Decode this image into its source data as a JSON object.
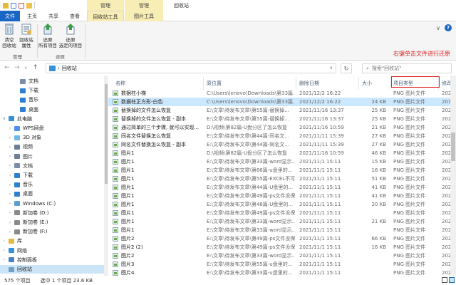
{
  "titlebar": {
    "context_tabs": [
      "管理",
      "管理"
    ],
    "title": "回收站"
  },
  "ribbon_tabs": {
    "file": "文件",
    "home": "主页",
    "share": "共享",
    "view": "查看",
    "recycle_tools": "回收站工具",
    "picture_tools": "图片工具"
  },
  "ribbon": {
    "empty_recycle": "清空\n回收站",
    "recycle_props": "回收站\n属性",
    "restore_all": "还原\n所有项目",
    "restore_selected": "还原\n选定的项目",
    "group_manage": "管理",
    "group_restore": "还原"
  },
  "annotation": "右键单击文件进行还原",
  "address": {
    "path_sep": "›",
    "path": "回收站",
    "search_placeholder": "搜索\"回收站\""
  },
  "nav": {
    "up": "↑",
    "back": "←",
    "forward": "→",
    "history": "∨",
    "refresh": "↻"
  },
  "navpane": [
    {
      "label": "文档",
      "color": "#7a8fa6",
      "arrow": ""
    },
    {
      "label": "下载",
      "color": "#2f7fd0",
      "arrow": ""
    },
    {
      "label": "音乐",
      "color": "#2f7fd0",
      "arrow": ""
    },
    {
      "label": "桌面",
      "color": "#2f7fd0",
      "arrow": ""
    },
    {
      "label": "此电脑",
      "color": "#3a8fd9",
      "arrow": "∨"
    },
    {
      "label": "WPS网盘",
      "color": "#4e8ff2",
      "arrow": "›"
    },
    {
      "label": "3D 对象",
      "color": "#6fb7e8",
      "arrow": "›"
    },
    {
      "label": "视频",
      "color": "#6b7f99",
      "arrow": "›"
    },
    {
      "label": "图片",
      "color": "#6b7f99",
      "arrow": "›"
    },
    {
      "label": "文档",
      "color": "#7a8fa6",
      "arrow": "›"
    },
    {
      "label": "下载",
      "color": "#2f7fd0",
      "arrow": "›"
    },
    {
      "label": "音乐",
      "color": "#2f7fd0",
      "arrow": "›"
    },
    {
      "label": "桌面",
      "color": "#2f7fd0",
      "arrow": "›"
    },
    {
      "label": "Windows (C:)",
      "color": "#5a9fd4",
      "arrow": "›"
    },
    {
      "label": "新加卷 (D:)",
      "color": "#8a8a8a",
      "arrow": "›"
    },
    {
      "label": "新加卷 (E:)",
      "color": "#8a8a8a",
      "arrow": "›"
    },
    {
      "label": "新加卷 (F:)",
      "color": "#8a8a8a",
      "arrow": "›"
    },
    {
      "label": "库",
      "color": "#e8b83c",
      "arrow": "›"
    },
    {
      "label": "网络",
      "color": "#3a8fd9",
      "arrow": "›"
    },
    {
      "label": "控制面板",
      "color": "#4a7fc1",
      "arrow": "›"
    },
    {
      "label": "回收站",
      "color": "#6fa0c8",
      "arrow": ""
    }
  ],
  "columns": {
    "name": "名称",
    "original": "原位置",
    "deleted": "删除日期",
    "size": "大小",
    "type": "项目类型",
    "modified": "修改"
  },
  "files": [
    {
      "name": "数据柱小梯",
      "orig": "C:\\Users\\lenovo\\Downloads\\第33篇...",
      "date": "2021/12/2 16:22",
      "size": "",
      "type": "PNG 图片文件",
      "mod": "202"
    },
    {
      "name": "数据柱正方形-白色",
      "orig": "C:\\Users\\lenovo\\Downloads\\第33篇...",
      "date": "2021/12/2 16:22",
      "size": "24 KB",
      "type": "PNG 图片文件",
      "mod": "201"
    },
    {
      "name": "替换掉的文件怎么恢复",
      "orig": "E:\\文章\\待发布文章\\第55篇-替换掉...",
      "date": "2021/11/16 13:37",
      "size": "25 KB",
      "type": "PNG 图片文件",
      "mod": "202"
    },
    {
      "name": "替换掉的文件怎么恢复 - 副本",
      "orig": "E:\\文章\\待发布文章\\第55篇-替换掉...",
      "date": "2021/11/16 13:37",
      "size": "25 KB",
      "type": "PNG 图片文件",
      "mod": "202"
    },
    {
      "name": "通过简单的三个步骤, 就可以实现...",
      "orig": "D:\\视频\\第82篇-U盘分区了怎么恢复",
      "date": "2021/11/16 10:59",
      "size": "21 KB",
      "type": "PNG 图片文件",
      "mod": "202"
    },
    {
      "name": "同名文件替换怎么恢复",
      "orig": "E:\\文章\\待发布文章\\第44篇-同名文...",
      "date": "2021/11/11 15:39",
      "size": "27 KB",
      "type": "PNG 图片文件",
      "mod": "202"
    },
    {
      "name": "同名文件替换怎么恢复 - 副本",
      "orig": "E:\\文章\\待发布文章\\第44篇-同名文...",
      "date": "2021/11/11 15:39",
      "size": "27 KB",
      "type": "PNG 图片文件",
      "mod": "202"
    },
    {
      "name": "图片1",
      "orig": "D:\\视频\\第82篇-U盘分区了怎么恢复",
      "date": "2021/11/16 10:59",
      "size": "46 KB",
      "type": "PNG 图片文件",
      "mod": "202"
    },
    {
      "name": "图片1",
      "orig": "E:\\文章\\待发布文章\\第33篇-word显示...",
      "date": "2021/11/1 15:11",
      "size": "15 KB",
      "type": "PNG 图片文件",
      "mod": "202"
    },
    {
      "name": "图片1",
      "orig": "E:\\文章\\待发布文章\\第66篇-u盘里的...",
      "date": "2021/11/1 15:11",
      "size": "16 KB",
      "type": "PNG 图片文件",
      "mod": "202"
    },
    {
      "name": "图片1",
      "orig": "E:\\文章\\待发布文章\\第55篇-EXCEL不可...",
      "date": "2021/11/1 15:11",
      "size": "51 KB",
      "type": "PNG 图片文件",
      "mod": "202"
    },
    {
      "name": "图片1",
      "orig": "E:\\文章\\待发布文章\\第44篇-U盘里的...",
      "date": "2021/11/1 15:11",
      "size": "41 KB",
      "type": "PNG 图片文件",
      "mod": "202"
    },
    {
      "name": "图片1",
      "orig": "E:\\文章\\待发布文章\\第49篇-ps文件没保...",
      "date": "2021/11/1 15:11",
      "size": "41 KB",
      "type": "PNG 图片文件",
      "mod": "202"
    },
    {
      "name": "图片1",
      "orig": "E:\\文章\\待发布文章\\第48篇-U盘里的...",
      "date": "2021/11/1 15:11",
      "size": "20 KB",
      "type": "PNG 图片文件",
      "mod": "202"
    },
    {
      "name": "图片1",
      "orig": "E:\\文章\\待发布文章\\第49篇-ps文件没保...",
      "date": "2021/11/1 15:11",
      "size": "",
      "type": "PNG 图片文件",
      "mod": "202"
    },
    {
      "name": "图片1",
      "orig": "E:\\文章\\待发布文章\\第33篇-word显示...",
      "date": "2021/11/1 15:11",
      "size": "21 KB",
      "type": "PNG 图片文件",
      "mod": "202"
    },
    {
      "name": "图片1",
      "orig": "E:\\文章\\待发布文章\\第33篇-word显示...",
      "date": "2021/11/1 15:11",
      "size": "",
      "type": "PNG 图片文件",
      "mod": "202"
    },
    {
      "name": "图片2",
      "orig": "E:\\文章\\待发布文章\\第49篇-ps文件没保...",
      "date": "2021/11/1 15:11",
      "size": "66 KB",
      "type": "PNG 图片文件",
      "mod": "202"
    },
    {
      "name": "图片2 (2)",
      "orig": "E:\\文章\\待发布文章\\第49篇-ps文件没保...",
      "date": "2021/11/1 15:11",
      "size": "16 KB",
      "type": "PNG 图片文件",
      "mod": "202"
    },
    {
      "name": "图片2",
      "orig": "E:\\文章\\待发布文章\\第33篇-word显示...",
      "date": "2021/11/1 15:11",
      "size": "",
      "type": "PNG 图片文件",
      "mod": "202"
    },
    {
      "name": "图片3",
      "orig": "E:\\文章\\待发布文章\\第55篇-u盘里的...",
      "date": "2021/11/1 15:11",
      "size": "",
      "type": "PNG 图片文件",
      "mod": "202"
    },
    {
      "name": "图片4",
      "orig": "E:\\文章\\待发布文章\\第33篇-u盘里的...",
      "date": "2021/11/1 15:11",
      "size": "",
      "type": "PNG 图片文件",
      "mod": "202"
    }
  ],
  "status": {
    "count": "575 个项目",
    "selected": "选中 1 个项目  23.6 KB"
  }
}
